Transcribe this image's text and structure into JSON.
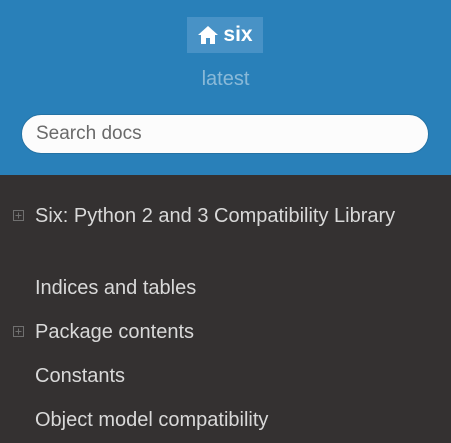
{
  "header": {
    "project_name": "six",
    "version": "latest",
    "home_icon": "home-icon"
  },
  "search": {
    "placeholder": "Search docs"
  },
  "colors": {
    "header_bg": "#2980b9",
    "nav_bg": "#343131",
    "nav_text": "#d9d9d9"
  },
  "nav": {
    "items": [
      {
        "label": "Six: Python 2 and 3 Compatibility Library",
        "expandable": true
      },
      {
        "label": "Indices and tables",
        "expandable": false
      },
      {
        "label": "Package contents",
        "expandable": true
      },
      {
        "label": "Constants",
        "expandable": false
      },
      {
        "label": "Object model compatibility",
        "expandable": false
      }
    ]
  }
}
